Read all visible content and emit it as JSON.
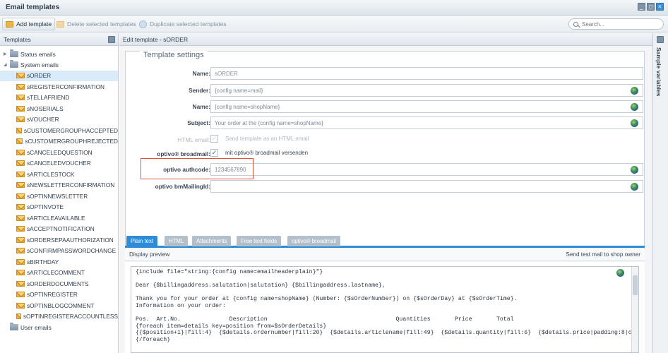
{
  "window": {
    "title": "Email templates"
  },
  "toolbar": {
    "add_label": "Add template",
    "delete_label": "Delete selected templates",
    "duplicate_label": "Duplicate selected templates",
    "search_placeholder": "Search..."
  },
  "sidebar": {
    "header": "Templates",
    "status_emails": "Status emails",
    "system_emails": "System emails",
    "items": [
      "sORDER",
      "sREGISTERCONFIRMATION",
      "sTELLAFRIEND",
      "sNOSERIALS",
      "sVOUCHER",
      "sCUSTOMERGROUPHACCEPTED",
      "sCUSTOMERGROUPHREJECTED",
      "sCANCELEDQUESTION",
      "sCANCELEDVOUCHER",
      "sARTICLESTOCK",
      "sNEWSLETTERCONFIRMATION",
      "sOPTINNEWSLETTER",
      "sOPTINVOTE",
      "sARTICLEAVAILABLE",
      "sACCEPTNOTIFICATION",
      "sORDERSEPAAUTHORIZATION",
      "sCONFIRMPASSWORDCHANGE",
      "sBIRTHDAY",
      "sARTICLECOMMENT",
      "sORDERDOCUMENTS",
      "sOPTINREGISTER",
      "sOPTINBLOGCOMMENT",
      "sOPTINREGISTERACCOUNTLESS"
    ],
    "selected": "sORDER",
    "user_emails": "User emails"
  },
  "main": {
    "header": "Edit template - sORDER",
    "legend": "Template settings",
    "fields": {
      "name_label": "Name:",
      "name_value": "sORDER",
      "sender_label": "Sender:",
      "sender_value": "{config name=mail}",
      "fromname_label": "Name:",
      "fromname_value": "{config name=shopName}",
      "subject_label": "Subject:",
      "subject_value": "Your order at the {config name=shopName}",
      "html_label": "HTML email:",
      "html_text": "Send template as an HTML email",
      "optivo_broadmail_label": "optivo® broadmail:",
      "optivo_broadmail_text": "mit optivo® broadmail versenden",
      "authcode_label": "optivo authcode:",
      "authcode_value": "1234567890",
      "mailingid_label": "optivo bmMailingId:",
      "mailingid_value": ""
    },
    "tabs": [
      "Plain text",
      "HTML",
      "Attachments",
      "Free text fields",
      "optivo® broadmail"
    ],
    "preview_label": "Display preview",
    "send_test_label": "Send test mail to shop owner",
    "code_lines": [
      "{include file=\"string:{config name=emailheaderplain}\"}",
      "",
      "Dear {$billingaddress.salutation|salutation} {$billingaddress.lastname},",
      "",
      "Thank you for your order at {config name=shopName} (Number: {$sOrderNumber}) on {$sOrderDay} at {$sOrderTime}.",
      "Information on your order:",
      "",
      "Pos.  Art.No.              Description                                     Quantities       Price       Total",
      "{foreach item=details key=position from=$sOrderDetails}",
      "{{$position+1}|fill:4}  {$details.ordernumber|fill:20}  {$details.articlename|fill:49}  {$details.quantity|fill:6}  {$details.price|padding:8|c",
      "{/foreach}"
    ]
  },
  "right_panel": {
    "title": "Sample variables"
  }
}
